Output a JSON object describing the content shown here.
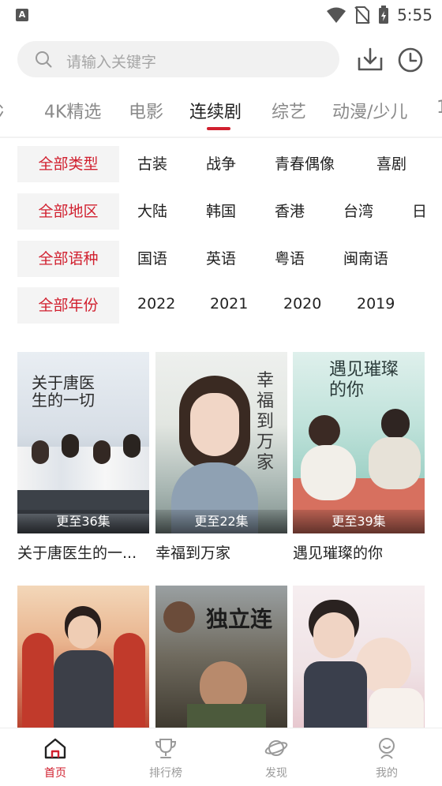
{
  "status_bar": {
    "time": "5:55",
    "app_icon_letter": "A"
  },
  "search": {
    "placeholder": "请输入关键字"
  },
  "tabs": [
    {
      "label": "4K精选"
    },
    {
      "label": "电影"
    },
    {
      "label": "连续剧"
    },
    {
      "label": "综艺"
    },
    {
      "label": "动漫/少儿"
    }
  ],
  "active_tab": "连续剧",
  "filters": {
    "type": {
      "tag": "全部类型",
      "options": [
        "古装",
        "战争",
        "青春偶像",
        "喜剧"
      ]
    },
    "region": {
      "tag": "全部地区",
      "options": [
        "大陆",
        "韩国",
        "香港",
        "台湾",
        "日"
      ]
    },
    "language": {
      "tag": "全部语种",
      "options": [
        "国语",
        "英语",
        "粤语",
        "闽南语"
      ]
    },
    "year": {
      "tag": "全部年份",
      "options": [
        "2022",
        "2021",
        "2020",
        "2019"
      ]
    }
  },
  "cards": [
    {
      "title": "关于唐医生的一...",
      "badge": "更至36集",
      "poster_text": "关于唐医生的一切"
    },
    {
      "title": "幸福到万家",
      "badge": "更至22集",
      "poster_text": "幸福到万家"
    },
    {
      "title": "遇见璀璨的你",
      "badge": "更至39集",
      "poster_text": "遇见璀璨的你"
    },
    {
      "title": "",
      "badge": "",
      "poster_text": ""
    },
    {
      "title": "",
      "badge": "",
      "poster_text": "独立连"
    },
    {
      "title": "",
      "badge": "",
      "poster_text": ""
    }
  ],
  "bottom_nav": [
    {
      "label": "首页"
    },
    {
      "label": "排行榜"
    },
    {
      "label": "发现"
    },
    {
      "label": "我的"
    }
  ],
  "colors": {
    "accent": "#d1202f",
    "inactive": "#9a9a9a",
    "filter_bg": "#f4f4f4"
  }
}
